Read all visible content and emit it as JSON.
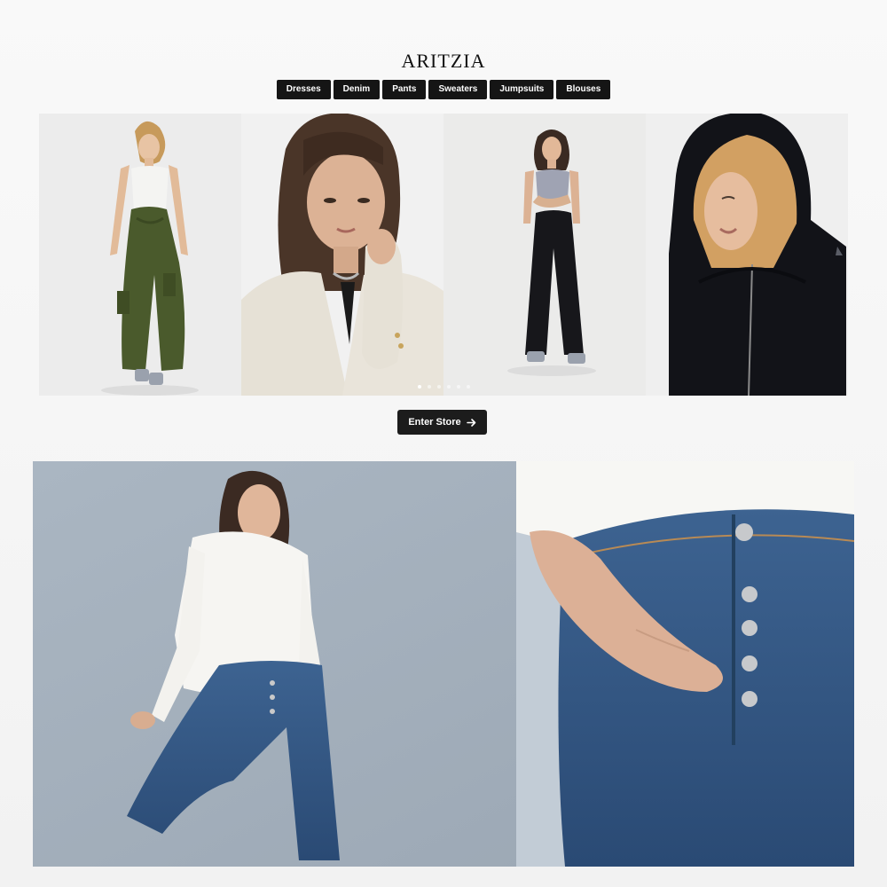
{
  "brand": {
    "logo": "ARITZIA"
  },
  "categories": [
    {
      "label": "Dresses"
    },
    {
      "label": "Denim"
    },
    {
      "label": "Pants"
    },
    {
      "label": "Sweaters"
    },
    {
      "label": "Jumpsuits"
    },
    {
      "label": "Blouses"
    }
  ],
  "carousel": {
    "slides": [
      {
        "icon": "model-cargo-pants-photo"
      },
      {
        "icon": "model-blazer-portrait-photo"
      },
      {
        "icon": "model-black-trousers-photo"
      },
      {
        "icon": "model-black-hoodie-photo"
      }
    ],
    "dot_count": 6,
    "active_dot": 1
  },
  "enter_store": {
    "label": "Enter Store",
    "icon": "arrow-right-icon"
  },
  "hero": {
    "icon": "denim-campaign-photo"
  },
  "colors": {
    "button_bg": "#151515",
    "button_text": "#ffffff",
    "page_bg": "#f6f6f6"
  }
}
